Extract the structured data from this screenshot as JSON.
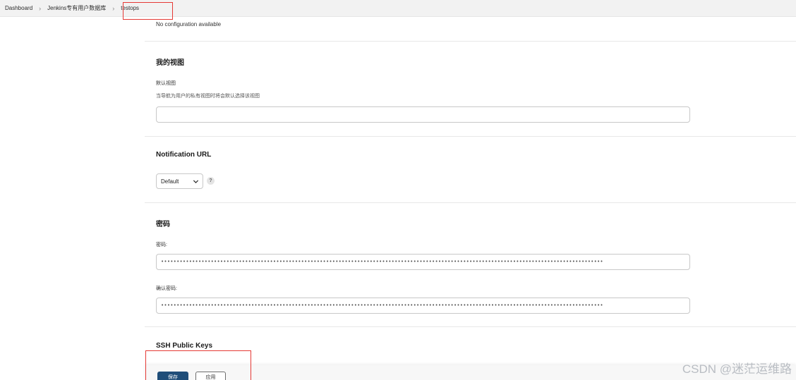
{
  "breadcrumb": {
    "items": [
      "Dashboard",
      "Jenkins专有用户数据库",
      "testops"
    ],
    "separator": ">"
  },
  "top_section": {
    "note": "No configuration available"
  },
  "my_views": {
    "title": "我的视图",
    "field_label": "默认视图",
    "field_desc": "当导航为用户的私有视图时将会默认选择该视图",
    "value": ""
  },
  "notification_url": {
    "title": "Notification URL",
    "selected": "Default",
    "help_label": "?"
  },
  "password": {
    "title": "密码",
    "password_label": "密码:",
    "password_value": "••••••••••••••••••••••••••••••••••••••••••••••••••••••••••••••••••••••••••••••••••••••••••••••••••••••••••••••••••••••••••••••••••••••••••••••",
    "confirm_label": "确认密码:",
    "confirm_value": "••••••••••••••••••••••••••••••••••••••••••••••••••••••••••••••••••••••••••••••••••••••••••••••••••••••••••••••••••••••••••••••••••••••••••••••"
  },
  "ssh": {
    "title": "SSH Public Keys"
  },
  "actions": {
    "save_label": "保存",
    "apply_label": "应用"
  },
  "watermark": "CSDN @迷茫运维路",
  "colors": {
    "primary_button": "#1f4e79",
    "highlight_border": "#e53935"
  }
}
